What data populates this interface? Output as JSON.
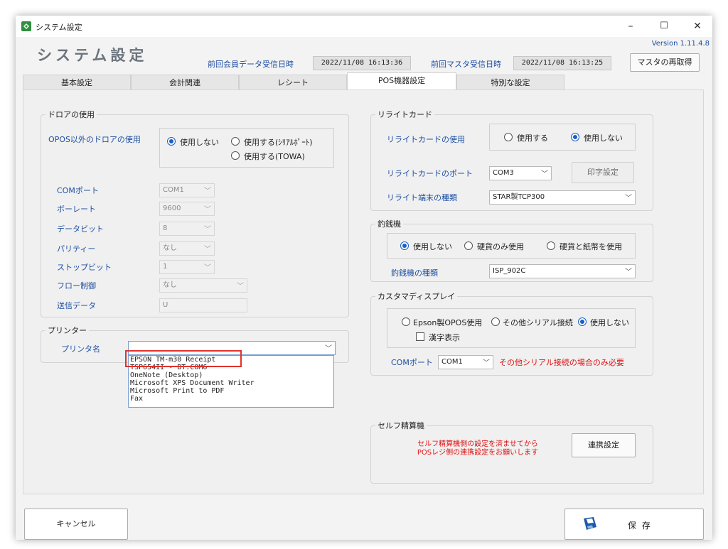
{
  "window": {
    "title": "システム設定",
    "controls": {
      "minimize": "–",
      "maximize": "☐",
      "close": "✕"
    }
  },
  "header": {
    "title": "システム設定",
    "version": "Version 1.11.4.8",
    "member_label": "前回会員データ受信日時",
    "member_value": "2022/11/08 16:13:36",
    "master_label": "前回マスタ受信日時",
    "master_value": "2022/11/08 16:13:25",
    "reload_button": "マスタの再取得"
  },
  "tabs": [
    {
      "label": "基本設定",
      "active": false
    },
    {
      "label": "会計関連",
      "active": false
    },
    {
      "label": "レシート",
      "active": false
    },
    {
      "label": "POS機器設定",
      "active": true
    },
    {
      "label": "特別な設定",
      "active": false
    }
  ],
  "drawer": {
    "title": "ドロアの使用",
    "opos_label": "OPOS以外のドロアの使用",
    "options": [
      "使用しない",
      "使用する(ｼﾘｱﾙﾎﾟｰﾄ)",
      "使用する(TOWA)"
    ],
    "selected": "使用しない",
    "fields": [
      {
        "label": "COMポート",
        "value": "COM1"
      },
      {
        "label": "ボーレート",
        "value": "9600"
      },
      {
        "label": "データビット",
        "value": "8"
      },
      {
        "label": "パリティー",
        "value": "なし"
      },
      {
        "label": "ストップビット",
        "value": "1"
      },
      {
        "label": "フロー制御",
        "value": "なし"
      },
      {
        "label": "送信データ",
        "value": "U"
      }
    ]
  },
  "printer": {
    "title": "プリンター",
    "name_label": "プリンタ名",
    "value": "",
    "options": [
      "EPSON TM-m30 Receipt",
      "TSP654II - BT:COM6",
      "OneNote (Desktop)",
      "Microsoft XPS Document Writer",
      "Microsoft Print to PDF",
      "Fax"
    ]
  },
  "rewrite": {
    "title": "リライトカード",
    "use_label": "リライトカードの使用",
    "options": [
      "使用する",
      "使用しない"
    ],
    "selected": "使用しない",
    "port_label": "リライトカードのポート",
    "port_value": "COM3",
    "print_button": "印字設定",
    "terminal_label": "リライト端末の種類",
    "terminal_value": "STAR製TCP300"
  },
  "changer": {
    "title": "釣銭機",
    "options": [
      "使用しない",
      "硬貨のみ使用",
      "硬貨と紙幣を使用"
    ],
    "selected": "使用しない",
    "type_label": "釣銭機の種類",
    "type_value": "ISP_902C"
  },
  "customer_display": {
    "title": "カスタマディスプレイ",
    "options": [
      "Epson製OPOS使用",
      "その他シリアル接続",
      "使用しない"
    ],
    "selected": "使用しない",
    "kanji_label": "漢字表示",
    "com_label": "COMポート",
    "com_value": "COM1",
    "note": "その他シリアル接続の場合のみ必要"
  },
  "self_checkout": {
    "title": "セルフ精算機",
    "message_line1": "セルフ精算機側の設定を済ませてから",
    "message_line2": "POSレジ側の連携設定をお願いします",
    "link_button": "連携設定"
  },
  "footer": {
    "cancel_button": "キャンセル",
    "save_button": "保 存"
  },
  "colors": {
    "label_blue": "#1e4fa1",
    "radio_blue": "#1a5fc4",
    "warning_red": "#e01010",
    "highlight_red": "#e0322b"
  }
}
